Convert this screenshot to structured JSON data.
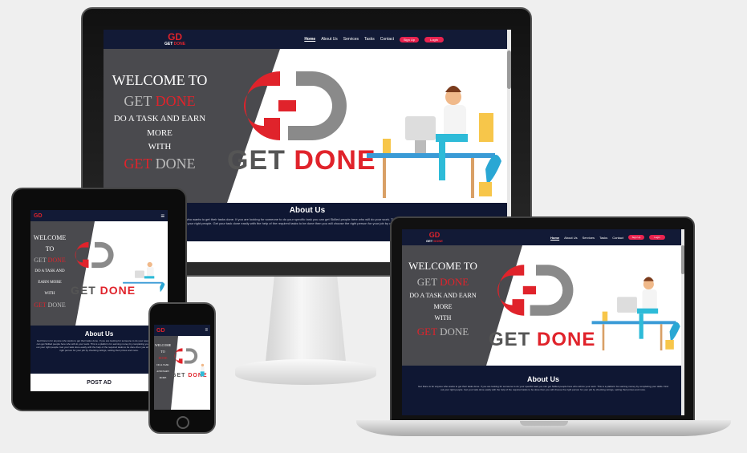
{
  "site": {
    "logo_mark": "GD",
    "logo_word_get": "GET",
    "logo_word_done": "DONE",
    "nav": [
      "Home",
      "About Us",
      "Services",
      "Tasks",
      "Contact"
    ],
    "signup": "Sign Up",
    "login": "Login",
    "hamburger": "≡",
    "hero": {
      "line1": "WELCOME TO",
      "line2_get": "GET",
      "line2_done": "DONE",
      "line3": "DO A TASK AND EARN MORE",
      "line4": "WITH",
      "line5_get": "GET",
      "line5_done": "DONE",
      "wordmark_get": "GET",
      "wordmark_done": "DONE"
    },
    "about": {
      "title": "About Us",
      "body": "Get Done is for anyone who wants to get their tasks done. If you are looking for someone to do your specific task you can get Skilled people here who will do your work. This is a platform for earning money by completing your skills. Find out your right people. Get your task done easily with the help of the required tasks to be done then you will choose the right person for your job by checking ratings, setting their prices and more."
    },
    "post_ad": "POST AD"
  },
  "colors": {
    "navy": "#121a36",
    "red": "#e0232b",
    "pink_button": "#e8234f",
    "hero_gray": "#4a4a4e",
    "about_bg": "#0f1733"
  }
}
